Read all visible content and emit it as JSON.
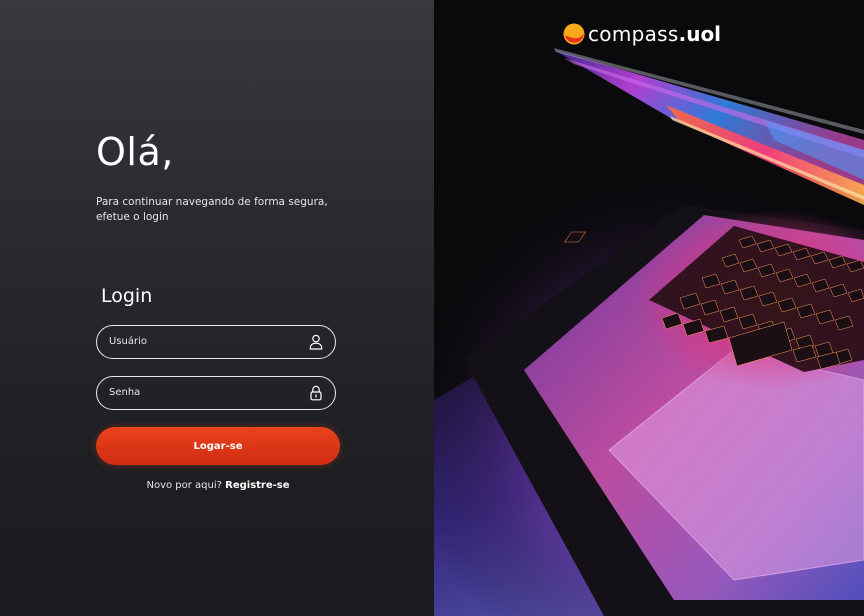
{
  "login_panel": {
    "greeting": "Olá,",
    "subtitle": "Para continuar navegando de forma segura, efetue o login",
    "section_title": "Login",
    "username": {
      "placeholder": "Usuário",
      "value": "",
      "icon": "user-icon"
    },
    "password": {
      "placeholder": "Senha",
      "value": "",
      "icon": "lock-icon"
    },
    "submit_label": "Logar-se",
    "register_prompt": "Novo por aqui?",
    "register_link": "Registre-se"
  },
  "brand": {
    "name": "compass",
    "suffix": ".uol",
    "accent_color": "#f26522"
  },
  "colors": {
    "primary_button": "#e0391a",
    "panel_background": "#26272b",
    "text": "#ffffff"
  }
}
